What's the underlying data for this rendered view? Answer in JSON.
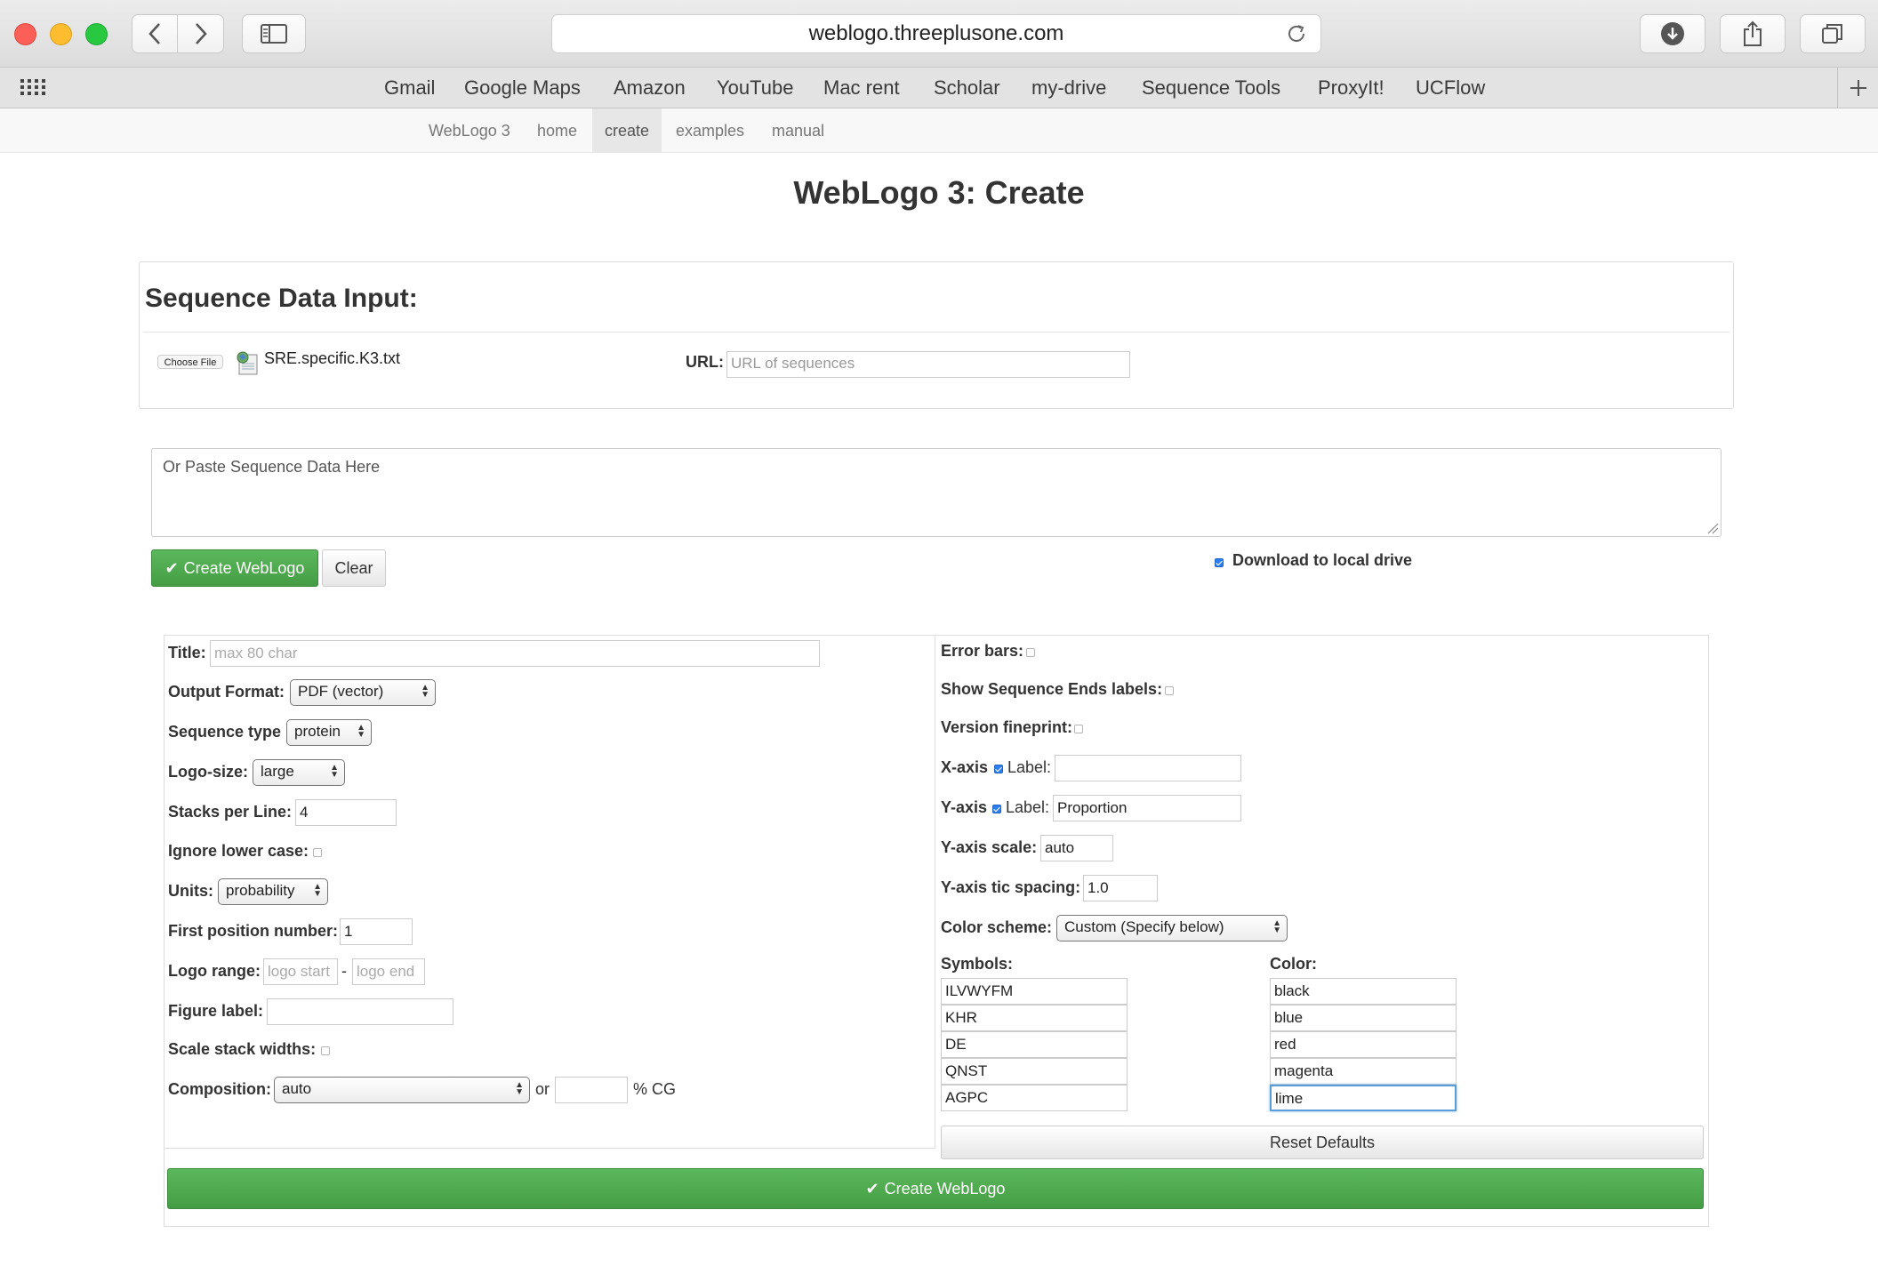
{
  "browser": {
    "url": "weblogo.threeplusone.com",
    "bookmarks": [
      "Gmail",
      "Google Maps",
      "Amazon",
      "YouTube",
      "Mac rent",
      "Scholar",
      "my-drive",
      "Sequence Tools",
      "ProxyIt!",
      "UCFlow"
    ]
  },
  "sitenav": {
    "items": [
      "WebLogo 3",
      "home",
      "create",
      "examples",
      "manual"
    ],
    "active": "create"
  },
  "page": {
    "title": "WebLogo 3: Create"
  },
  "input_panel": {
    "heading": "Sequence Data Input:",
    "choose_file_label": "Choose File",
    "file_name": "SRE.specific.K3.txt",
    "url_label": "URL:",
    "url_placeholder": "URL of sequences",
    "paste_placeholder": "Or Paste Sequence Data Here"
  },
  "actions": {
    "create_label": "Create WebLogo",
    "clear_label": "Clear",
    "download_label": "Download to local drive",
    "download_checked": true
  },
  "options_left": {
    "title_label": "Title:",
    "title_placeholder": "max 80 char",
    "output_format_label": "Output Format:",
    "output_format_value": "PDF (vector)",
    "sequence_type_label": "Sequence type",
    "sequence_type_value": "protein",
    "logo_size_label": "Logo-size:",
    "logo_size_value": "large",
    "stacks_label": "Stacks per Line:",
    "stacks_value": "4",
    "ignore_lower_label": "Ignore lower case:",
    "units_label": "Units:",
    "units_value": "probability",
    "first_pos_label": "First position number:",
    "first_pos_value": "1",
    "logo_range_label": "Logo range:",
    "logo_start_placeholder": "logo start",
    "range_sep": "-",
    "logo_end_placeholder": "logo end",
    "figure_label_label": "Figure label:",
    "scale_widths_label": "Scale stack widths:",
    "composition_label": "Composition:",
    "composition_value": "auto",
    "composition_or": "or",
    "composition_cg": "% CG"
  },
  "options_right": {
    "error_bars_label": "Error bars:",
    "seq_ends_label": "Show Sequence Ends labels:",
    "version_label": "Version fineprint:",
    "xaxis_label": "X-axis",
    "xaxis_label_text": "Label:",
    "xaxis_value": "",
    "yaxis_label": "Y-axis",
    "yaxis_label_text": "Label:",
    "yaxis_value": "Proportion",
    "yscale_label": "Y-axis scale:",
    "yscale_value": "auto",
    "ytic_label": "Y-axis tic spacing:",
    "ytic_value": "1.0",
    "color_scheme_label": "Color scheme:",
    "color_scheme_value": "Custom (Specify below)",
    "symbols_header": "Symbols:",
    "color_header": "Color:",
    "symbols": [
      "ILVWYFM",
      "KHR",
      "DE",
      "QNST",
      "AGPC"
    ],
    "colors": [
      "black",
      "blue",
      "red",
      "magenta",
      "lime"
    ],
    "reset_label": "Reset Defaults"
  },
  "theme": {
    "primary_green": "#5cb85c",
    "checkbox_blue": "#2d7ff0"
  }
}
